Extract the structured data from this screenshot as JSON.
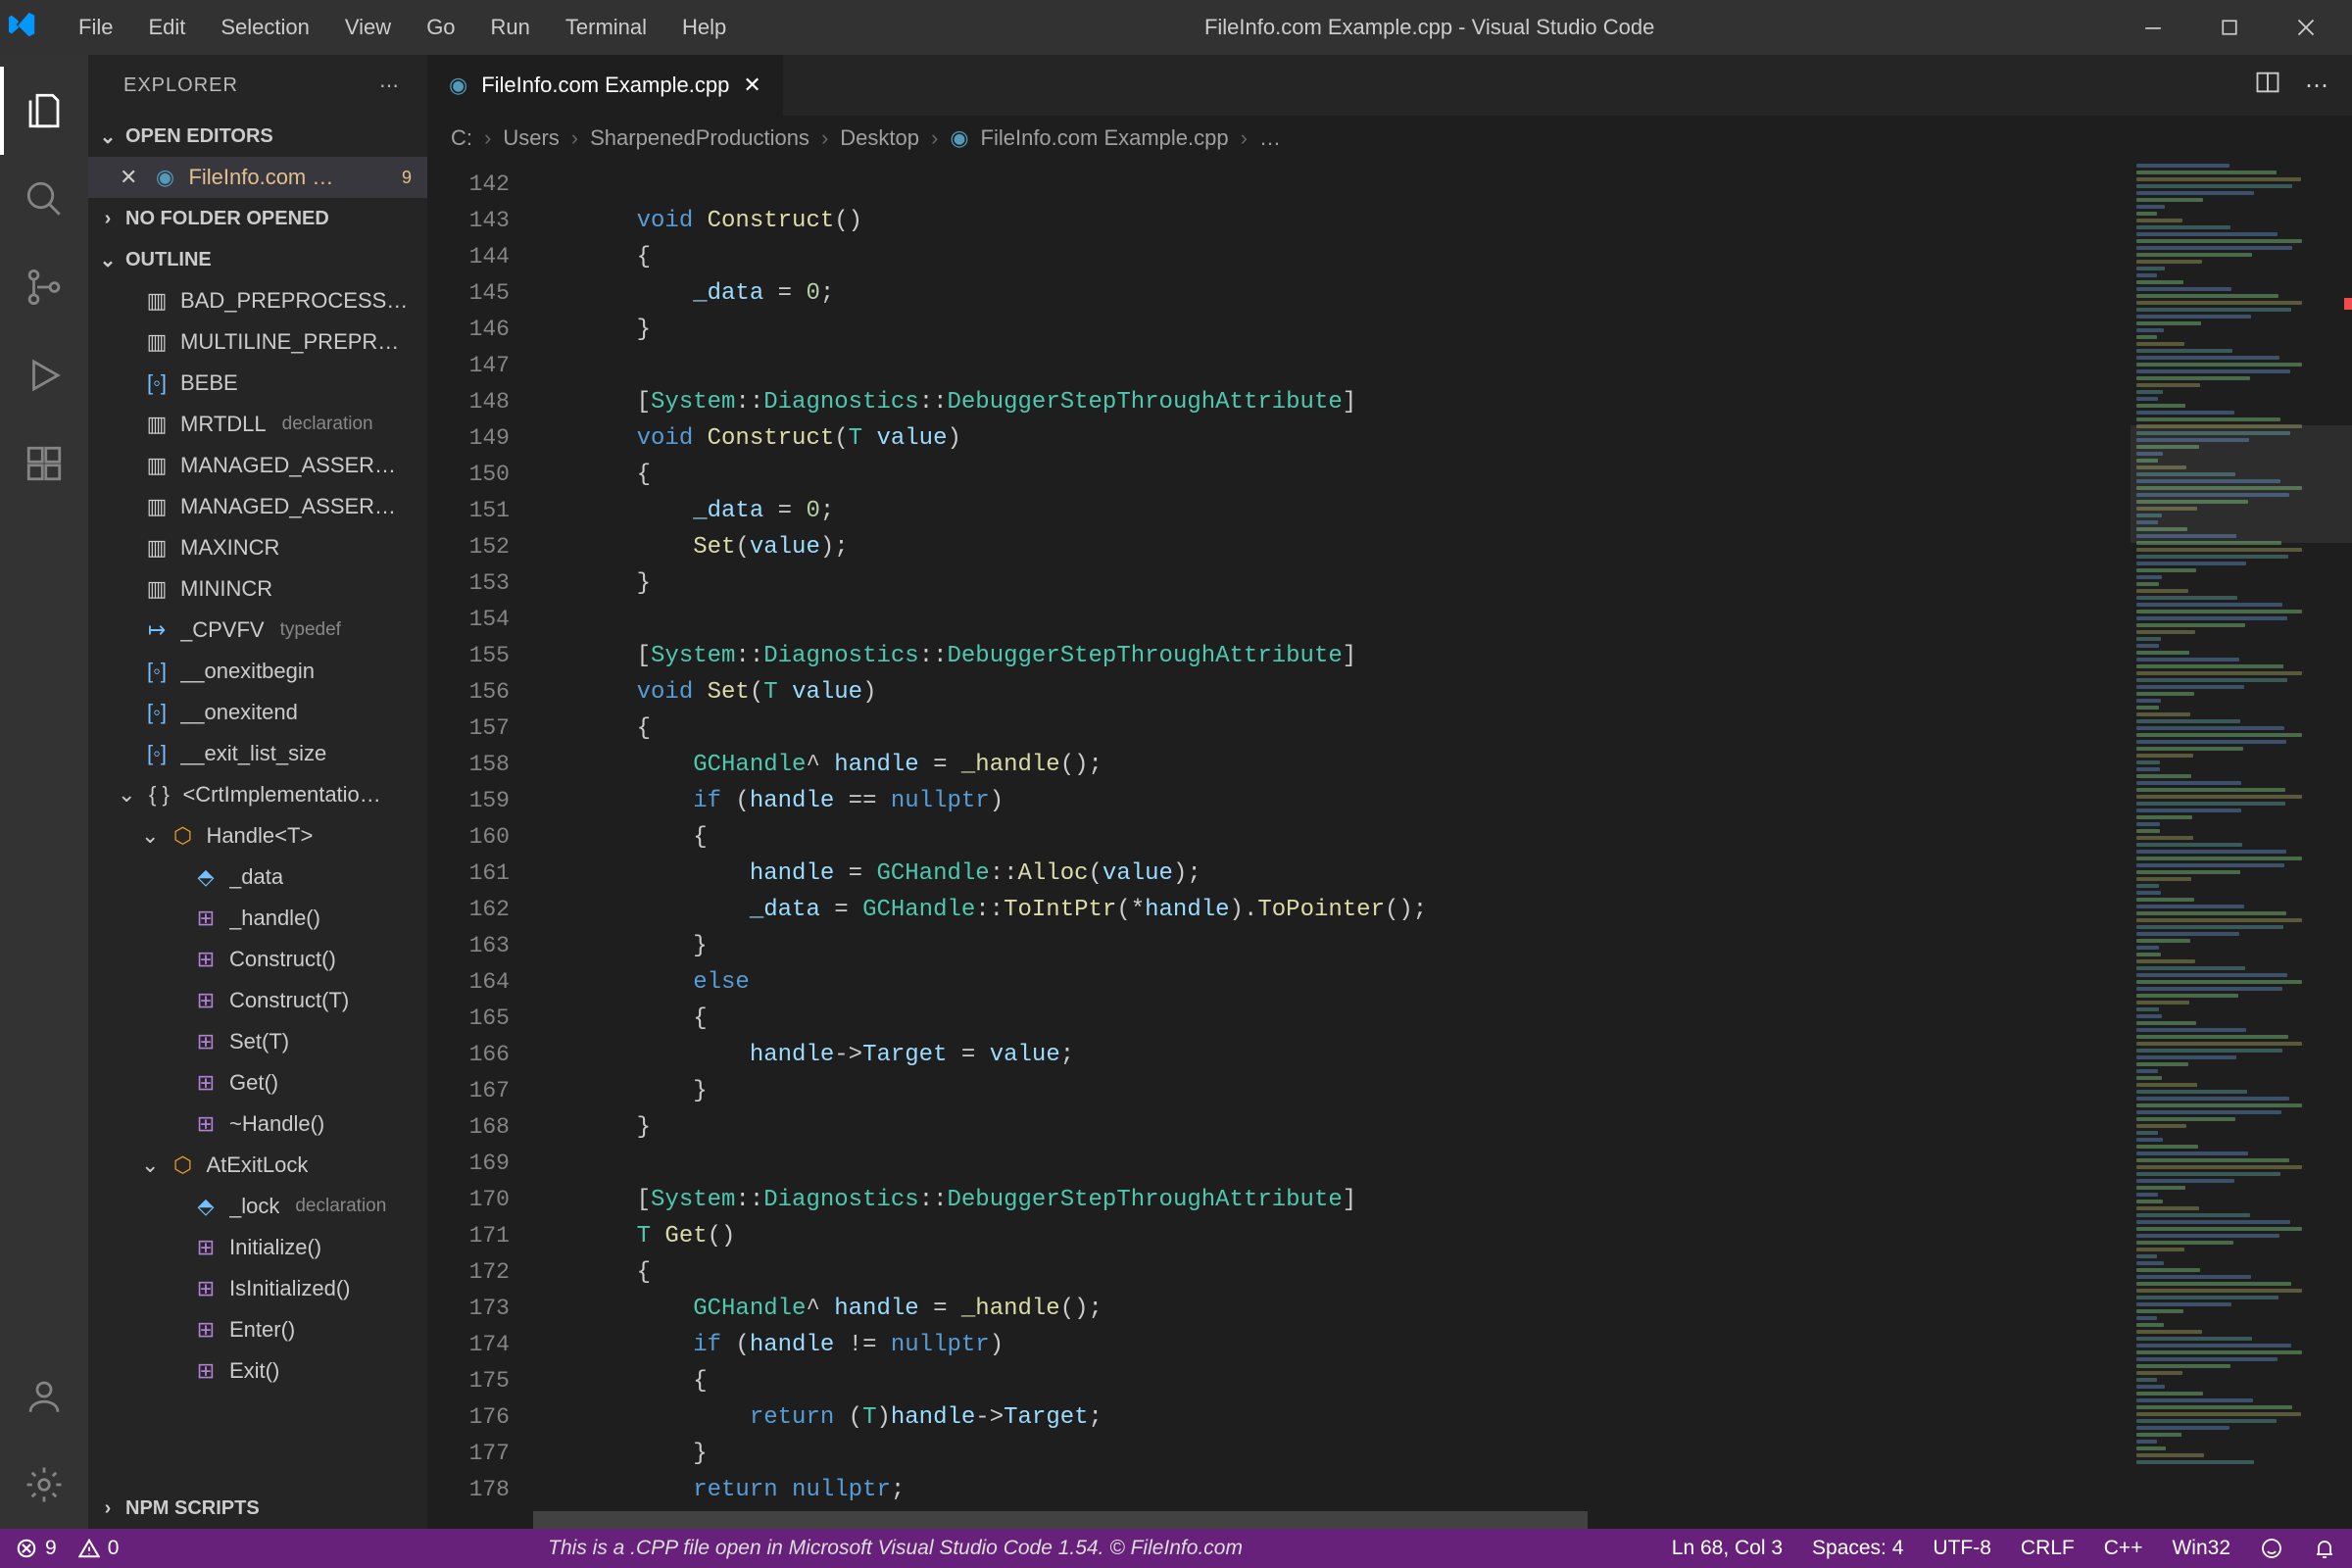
{
  "window": {
    "title": "FileInfo.com Example.cpp - Visual Studio Code"
  },
  "menu": [
    "File",
    "Edit",
    "Selection",
    "View",
    "Go",
    "Run",
    "Terminal",
    "Help"
  ],
  "sidebar": {
    "title": "EXPLORER",
    "sections": {
      "open_editors": "OPEN EDITORS",
      "no_folder": "NO FOLDER OPENED",
      "outline": "OUTLINE",
      "npm_scripts": "NPM SCRIPTS"
    },
    "open_editor": {
      "label": "FileInfo.com …",
      "badge": "9"
    },
    "outline_items": [
      {
        "icon": "struct",
        "label": "BAD_PREPROCESS…",
        "hint": ""
      },
      {
        "icon": "struct",
        "label": "MULTILINE_PREPR…",
        "hint": ""
      },
      {
        "icon": "var",
        "label": "BEBE",
        "hint": ""
      },
      {
        "icon": "struct",
        "label": "MRTDLL",
        "hint": "declaration"
      },
      {
        "icon": "struct",
        "label": "MANAGED_ASSER…",
        "hint": ""
      },
      {
        "icon": "struct",
        "label": "MANAGED_ASSER…",
        "hint": ""
      },
      {
        "icon": "struct",
        "label": "MAXINCR",
        "hint": ""
      },
      {
        "icon": "struct",
        "label": "MININCR",
        "hint": ""
      },
      {
        "icon": "key",
        "label": "_CPVFV",
        "hint": "typedef"
      },
      {
        "icon": "var",
        "label": "__onexitbegin",
        "hint": ""
      },
      {
        "icon": "var",
        "label": "__onexitend",
        "hint": ""
      },
      {
        "icon": "var",
        "label": "__exit_list_size",
        "hint": ""
      }
    ],
    "outline_ns": {
      "label": "<CrtImplementatio…"
    },
    "outline_class": {
      "label": "Handle<T>"
    },
    "outline_members": [
      {
        "icon": "field",
        "label": "_data"
      },
      {
        "icon": "method",
        "label": "_handle()"
      },
      {
        "icon": "method",
        "label": "Construct()"
      },
      {
        "icon": "method",
        "label": "Construct(T)"
      },
      {
        "icon": "method",
        "label": "Set(T)"
      },
      {
        "icon": "method",
        "label": "Get()"
      },
      {
        "icon": "method",
        "label": "~Handle()"
      }
    ],
    "outline_class2": {
      "label": "AtExitLock"
    },
    "outline_members2": [
      {
        "icon": "field",
        "label": "_lock",
        "hint": "declaration"
      },
      {
        "icon": "method",
        "label": "Initialize()"
      },
      {
        "icon": "method",
        "label": "IsInitialized()"
      },
      {
        "icon": "method",
        "label": "Enter()"
      },
      {
        "icon": "method",
        "label": "Exit()"
      }
    ]
  },
  "tab": {
    "label": "FileInfo.com Example.cpp"
  },
  "breadcrumb": {
    "parts": [
      "C:",
      "Users",
      "SharpenedProductions",
      "Desktop"
    ],
    "file": "FileInfo.com Example.cpp",
    "tail": "…"
  },
  "editor": {
    "first_line": 142,
    "last_line": 178
  },
  "status": {
    "errors": "9",
    "warnings": "0",
    "message": "This is a .CPP file open in Microsoft Visual Studio Code 1.54. © FileInfo.com",
    "ln_col": "Ln 68, Col 3",
    "spaces": "Spaces: 4",
    "encoding": "UTF-8",
    "eol": "CRLF",
    "lang": "C++",
    "os": "Win32"
  }
}
